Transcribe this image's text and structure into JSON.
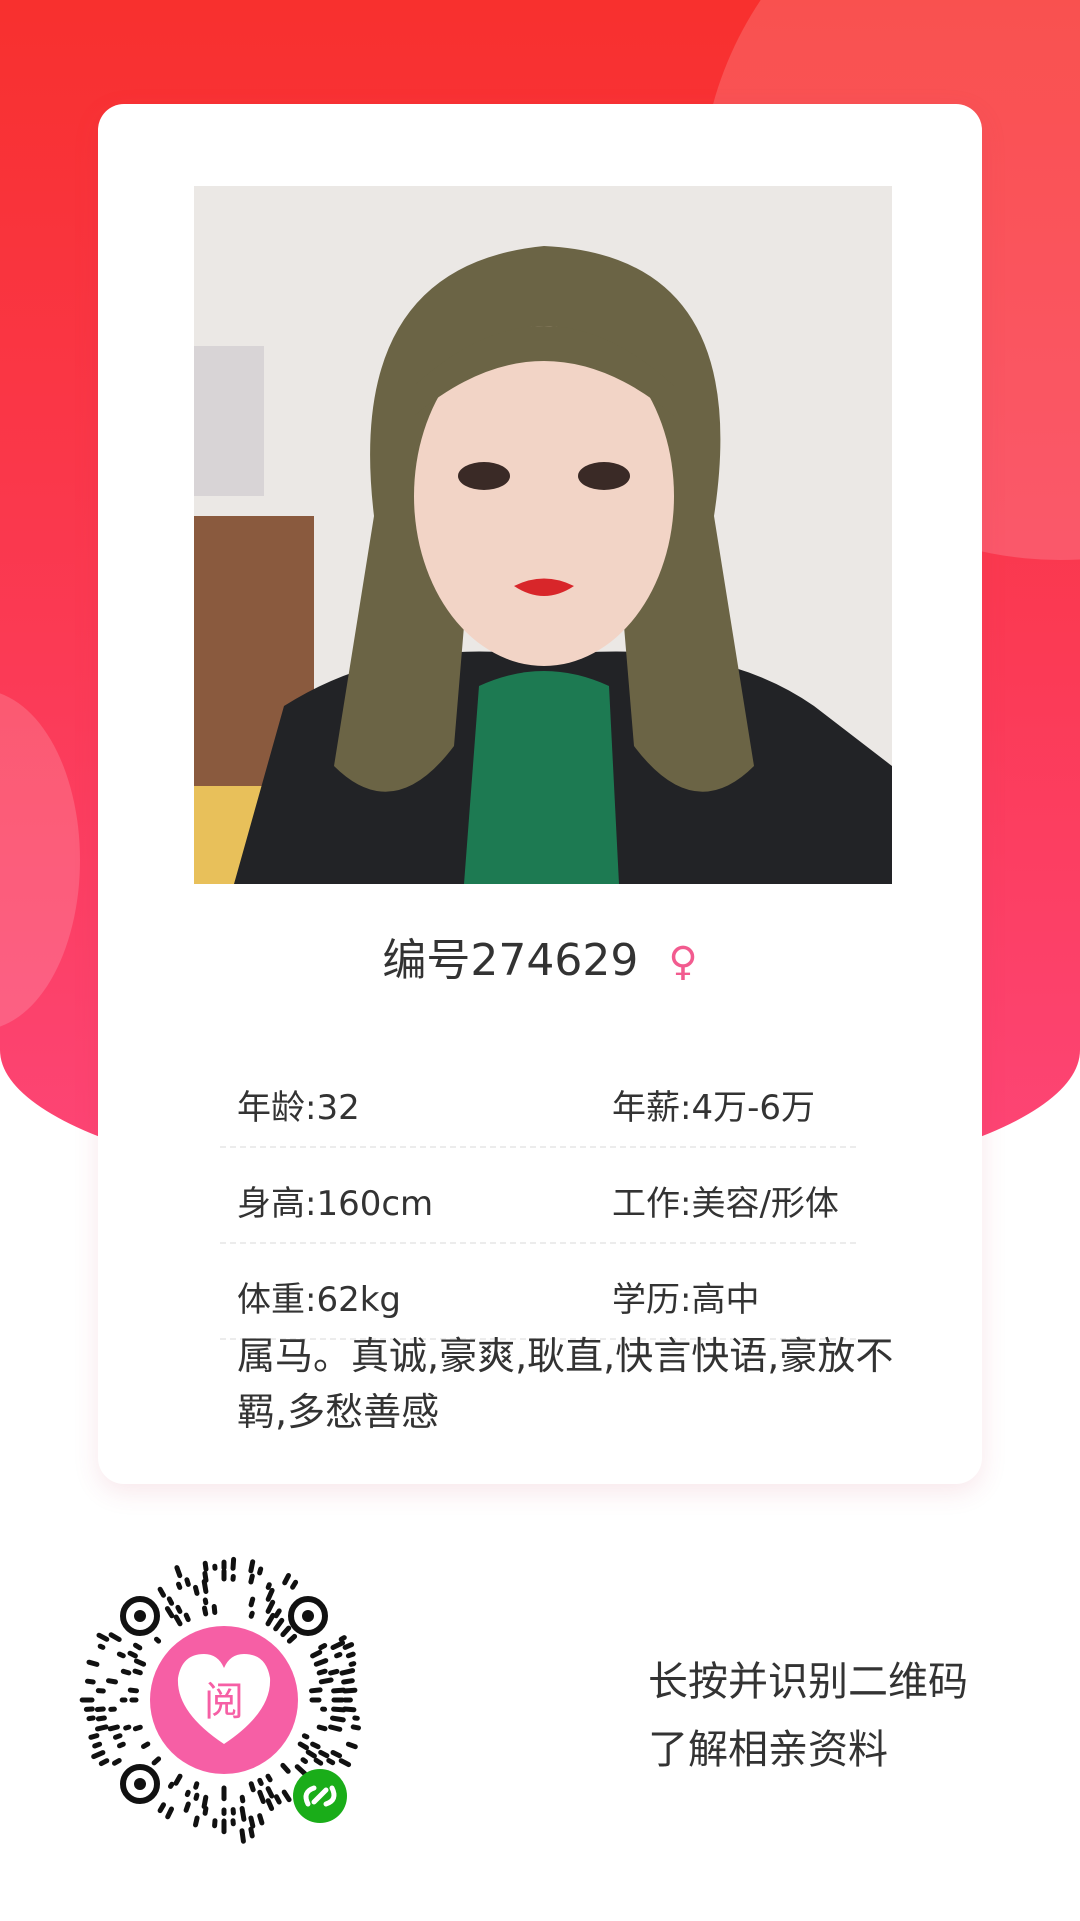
{
  "profile": {
    "id_label": "编号274629",
    "gender_symbol": "♀",
    "photo_desc": "profile-photo",
    "rows": [
      {
        "left": "年龄:32",
        "right": "年薪:4万-6万"
      },
      {
        "left": "身高:160cm",
        "right": "工作:美容/形体"
      },
      {
        "left": "体重:62kg",
        "right": "学历:高中"
      }
    ],
    "description": "属马。真诚,豪爽,耿直,快言快语,豪放不羁,多愁善感"
  },
  "qr": {
    "logo_text": "阅",
    "icon": "mini-program-qr-code"
  },
  "hint": {
    "line1": "长按并识别二维码",
    "line2": "了解相亲资料"
  },
  "colors": {
    "brand_red": "#f8302e",
    "brand_pink": "#fd4678",
    "gender_pink": "#f25b8f",
    "wechat_green": "#1aad19"
  }
}
